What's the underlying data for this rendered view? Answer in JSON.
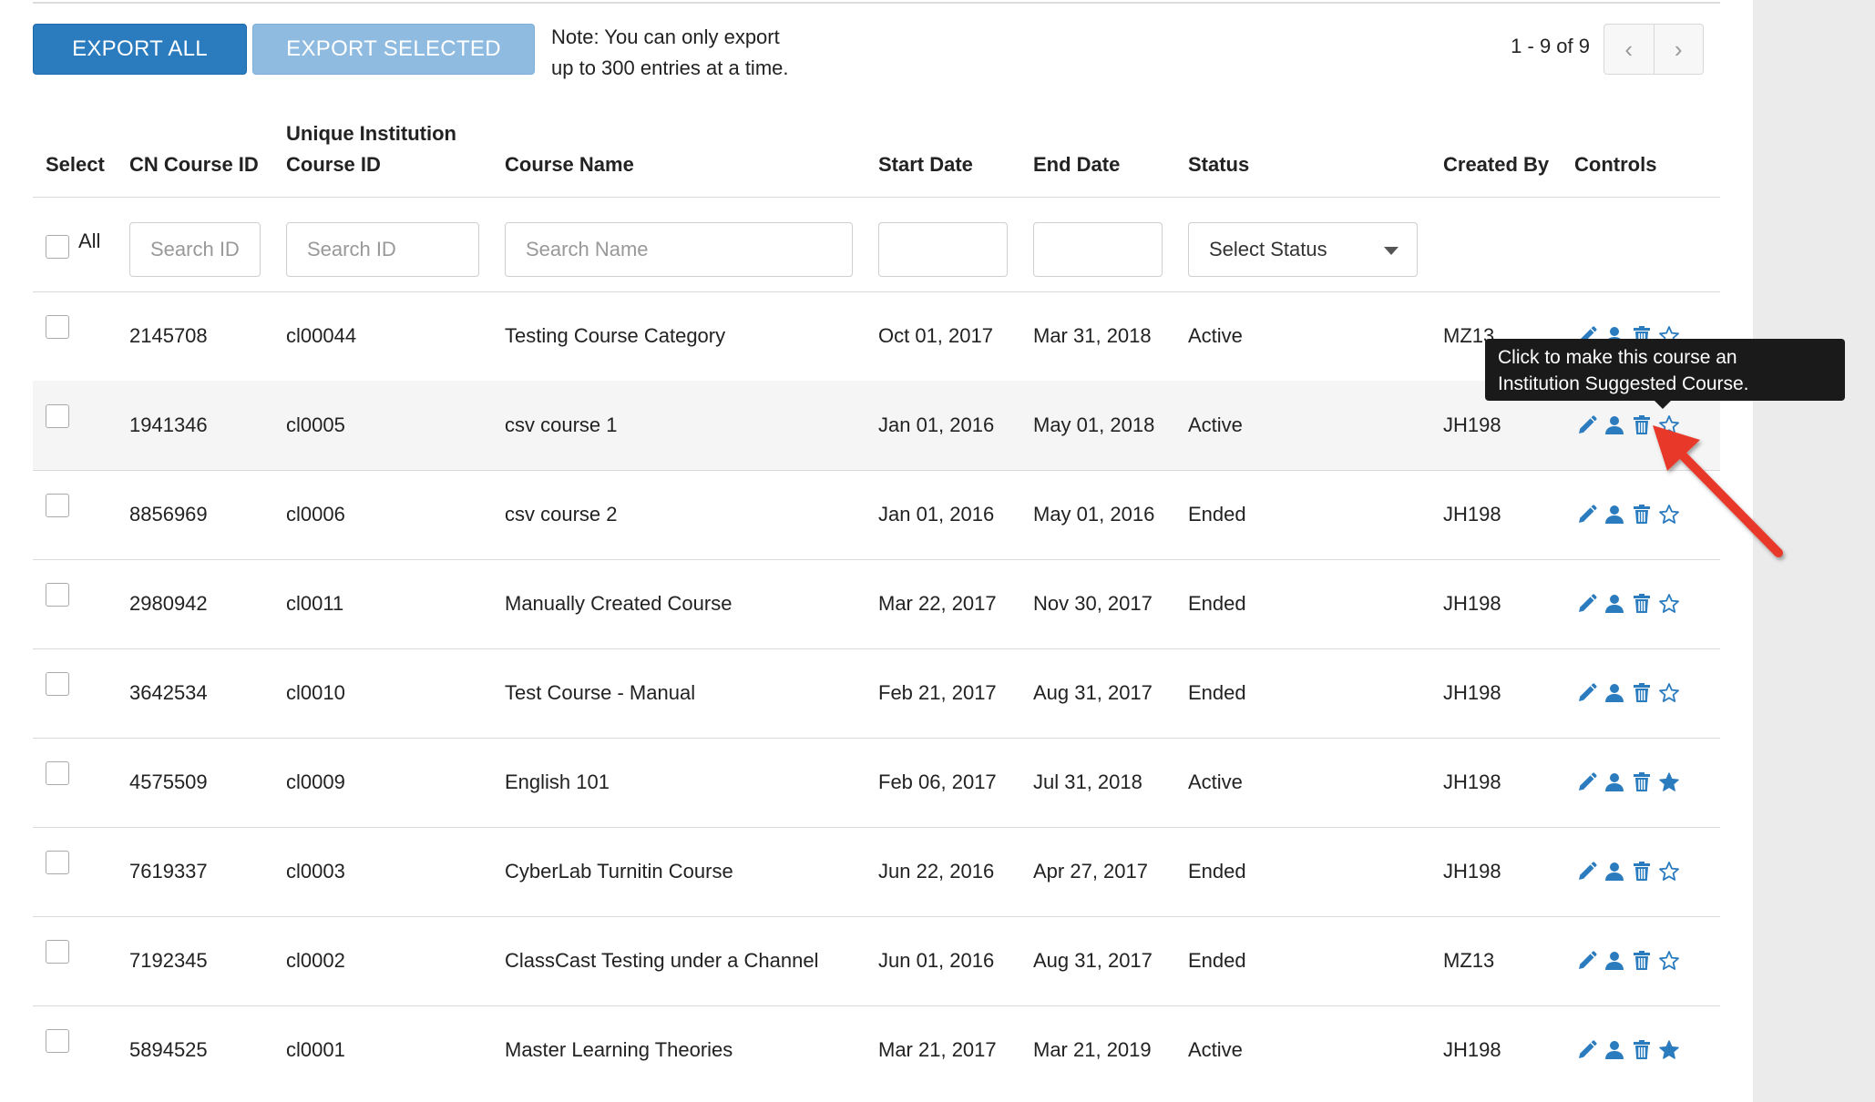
{
  "toolbar": {
    "export_all_label": "EXPORT ALL",
    "export_selected_label": "EXPORT SELECTED",
    "note_line1": "Note: You can only export",
    "note_line2": "up to 300 entries at a time."
  },
  "pagination": {
    "range_text": "1 - 9 of 9",
    "prev_glyph": "‹",
    "next_glyph": "›"
  },
  "table": {
    "headers": {
      "select": "Select",
      "cn_course_id": "CN Course ID",
      "unique_id_line1": "Unique Institution",
      "unique_id_line2": "Course ID",
      "course_name": "Course Name",
      "start_date": "Start Date",
      "end_date": "End Date",
      "status": "Status",
      "created_by": "Created By",
      "controls": "Controls"
    },
    "filters": {
      "all_label": "All",
      "cn_id_placeholder": "Search ID",
      "unique_id_placeholder": "Search ID",
      "name_placeholder": "Search Name",
      "status_select_value": "Select Status"
    },
    "rows": [
      {
        "cn_id": "2145708",
        "unique_id": "cl00044",
        "name": "Testing Course Category",
        "start": "Oct 01, 2017",
        "end": "Mar 31, 2018",
        "status": "Active",
        "created_by": "MZ13",
        "suggested": false
      },
      {
        "cn_id": "1941346",
        "unique_id": "cl0005",
        "name": "csv course 1",
        "start": "Jan 01, 2016",
        "end": "May 01, 2018",
        "status": "Active",
        "created_by": "JH198",
        "suggested": false
      },
      {
        "cn_id": "8856969",
        "unique_id": "cl0006",
        "name": "csv course 2",
        "start": "Jan 01, 2016",
        "end": "May 01, 2016",
        "status": "Ended",
        "created_by": "JH198",
        "suggested": false
      },
      {
        "cn_id": "2980942",
        "unique_id": "cl0011",
        "name": "Manually Created Course",
        "start": "Mar 22, 2017",
        "end": "Nov 30, 2017",
        "status": "Ended",
        "created_by": "JH198",
        "suggested": false
      },
      {
        "cn_id": "3642534",
        "unique_id": "cl0010",
        "name": "Test Course - Manual",
        "start": "Feb 21, 2017",
        "end": "Aug 31, 2017",
        "status": "Ended",
        "created_by": "JH198",
        "suggested": false
      },
      {
        "cn_id": "4575509",
        "unique_id": "cl0009",
        "name": "English 101",
        "start": "Feb 06, 2017",
        "end": "Jul 31, 2018",
        "status": "Active",
        "created_by": "JH198",
        "suggested": true
      },
      {
        "cn_id": "7619337",
        "unique_id": "cl0003",
        "name": "CyberLab Turnitin Course",
        "start": "Jun 22, 2016",
        "end": "Apr 27, 2017",
        "status": "Ended",
        "created_by": "JH198",
        "suggested": false
      },
      {
        "cn_id": "7192345",
        "unique_id": "cl0002",
        "name": "ClassCast Testing under a Channel",
        "start": "Jun 01, 2016",
        "end": "Aug 31, 2017",
        "status": "Ended",
        "created_by": "MZ13",
        "suggested": false
      },
      {
        "cn_id": "5894525",
        "unique_id": "cl0001",
        "name": "Master Learning Theories",
        "start": "Mar 21, 2017",
        "end": "Mar 21, 2019",
        "status": "Active",
        "created_by": "JH198",
        "suggested": true
      }
    ]
  },
  "tooltip": {
    "line1": "Click to make this course an",
    "line2": "Institution Suggested Course."
  },
  "icons": {
    "edit": "pencil-icon",
    "enroll": "user-icon",
    "delete": "trash-icon",
    "suggest": "star-icon"
  },
  "colors": {
    "primary": "#2b7bbf",
    "primary_disabled": "#8fbbe0",
    "icon": "#2b7bbf",
    "annotation_arrow": "#e8382a"
  }
}
